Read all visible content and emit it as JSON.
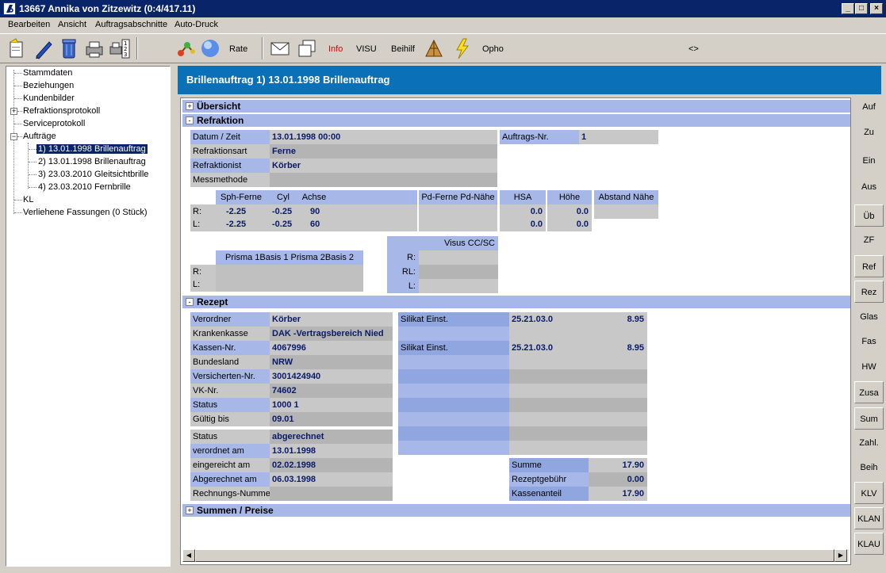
{
  "window": {
    "title": "13667  Annika von Zitzewitz  (0:4/417.11)",
    "minimize": "_",
    "maximize": "□",
    "close": "×"
  },
  "menu": [
    "Bearbeiten",
    "Ansicht",
    "Auftragsabschnitte",
    "Auto-Druck"
  ],
  "toolbar": {
    "rate": "Rate",
    "info": "Info",
    "visu": "VISU",
    "beihilf": "Beihilf",
    "opho": "Opho",
    "arrows": "<>"
  },
  "tree": {
    "items": [
      "Stammdaten",
      "Beziehungen",
      "Kundenbilder",
      "Refraktionsprotokoll",
      "Serviceprotokoll",
      "Aufträge",
      "1) 13.01.1998 Brillenauftrag",
      "2) 13.01.1998 Brillenauftrag",
      "3) 23.03.2010 Gleitsichtbrille",
      "4) 23.03.2010 Fernbrille",
      "KL",
      "Verliehene Fassungen (0 Stück)"
    ]
  },
  "header": {
    "title": "Brillenauftrag   1)  13.01.1998 Brillenauftrag"
  },
  "sections": {
    "uebersicht": "Übersicht",
    "refraktion": "Refraktion",
    "rezept": "Rezept",
    "summen": "Summen / Preise",
    "plus": "+",
    "minus": "-"
  },
  "refraktion": {
    "datum_label": "Datum / Zeit",
    "datum_value": "13.01.1998 00:00",
    "art_label": "Refraktionsart",
    "art_value": "Ferne",
    "refraktionist_label": "Refraktionist",
    "refraktionist_value": "Körber",
    "messmethode_label": "Messmethode",
    "auftrag_label": "Auftrags-Nr.",
    "auftrag_value": "1",
    "col_sph": "Sph-Ferne",
    "col_cyl": "Cyl",
    "col_achse": "Achse",
    "col_pd": "Pd-Ferne Pd-Nähe",
    "col_hsa": "HSA",
    "col_hoehe": "Höhe",
    "col_abstand": "Abstand Nähe",
    "r": "R:",
    "l": "L:",
    "rl": "RL:",
    "r_sph": "-2.25",
    "r_cyl": "-0.25",
    "r_achse": "90",
    "l_sph": "-2.25",
    "l_cyl": "-0.25",
    "l_achse": "60",
    "r_hsa": "0.0",
    "r_hoehe": "0.0",
    "l_hsa": "0.0",
    "l_hoehe": "0.0",
    "prisma_hdr": "Prisma 1Basis 1      Prisma 2Basis 2",
    "visus_hdr": "Visus CC/SC"
  },
  "rezept": {
    "rows": [
      {
        "label": "Verordner",
        "value": "Körber"
      },
      {
        "label": "Krankenkasse",
        "value": "DAK -Vertragsbereich Nied"
      },
      {
        "label": "Kassen-Nr.",
        "value": "4067996"
      },
      {
        "label": "Bundesland",
        "value": "NRW"
      },
      {
        "label": "Versicherten-Nr.",
        "value": "3001424940"
      },
      {
        "label": "VK-Nr.",
        "value": "74602"
      },
      {
        "label": "Status",
        "value": "1000 1"
      },
      {
        "label": "Gültig bis",
        "value": "09.01"
      }
    ],
    "status_rows": [
      {
        "label": "Status",
        "value": "abgerechnet"
      },
      {
        "label": "verordnet am",
        "value": "13.01.1998"
      },
      {
        "label": "eingereicht am",
        "value": "02.02.1998"
      },
      {
        "label": "Abgerechnet am",
        "value": "06.03.1998"
      },
      {
        "label": "Rechnungs-Nummer",
        "value": ""
      }
    ],
    "items": [
      {
        "name": "Silikat Einst.",
        "code": "25.21.03.0",
        "price": "8.95"
      },
      {
        "name": "",
        "code": "",
        "price": ""
      },
      {
        "name": "Silikat Einst.",
        "code": "25.21.03.0",
        "price": "8.95"
      }
    ],
    "summe_label": "Summe",
    "summe_value": "17.90",
    "gebuehr_label": "Rezeptgebühr",
    "gebuehr_value": "0.00",
    "anteil_label": "Kassenanteil",
    "anteil_value": "17.90"
  },
  "scroll": {
    "left": "◀",
    "right": "▶"
  },
  "rightnav": [
    "Auf",
    "Zu",
    "Ein",
    "Aus",
    "Üb",
    "ZF",
    "Ref",
    "Rez",
    "Glas",
    "Fas",
    "HW",
    "Zusa",
    "Sum",
    "Zahl.",
    "Beih",
    "KLV",
    "KLAN",
    "KLAU"
  ]
}
